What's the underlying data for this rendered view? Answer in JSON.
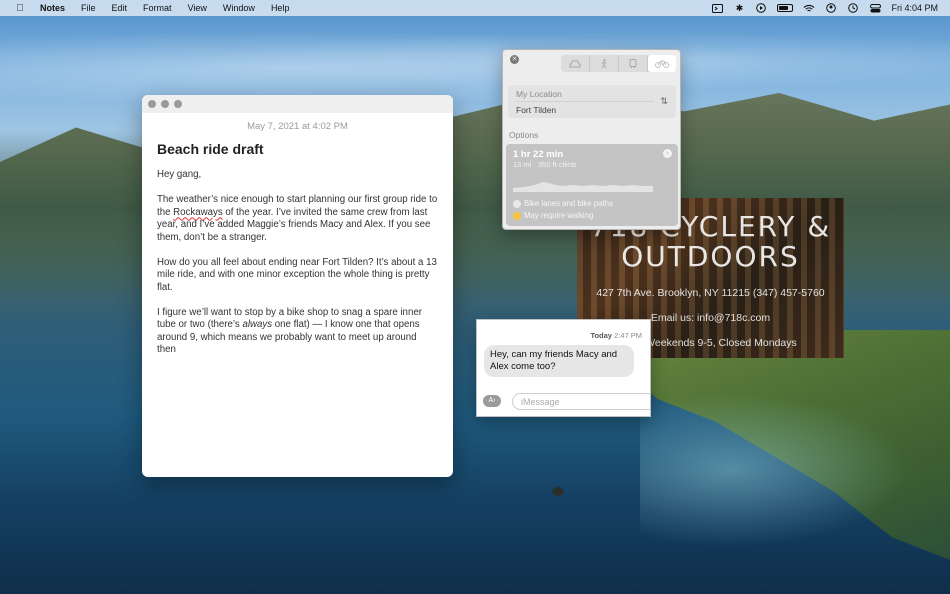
{
  "menubar": {
    "apple_icon": "apple-logo",
    "app_name": "Notes",
    "menus": [
      "File",
      "Edit",
      "Format",
      "View",
      "Window",
      "Help"
    ],
    "status_icons": [
      "screen-recording-icon",
      "bluetooth-icon",
      "play-icon",
      "battery-icon",
      "wifi-icon",
      "user-icon",
      "time-machine-icon",
      "control-center-icon"
    ],
    "clock": "Fri 4:04 PM"
  },
  "notes": {
    "date": "May 7, 2021 at 4:02 PM",
    "title": "Beach ride draft",
    "greeting": "Hey gang,",
    "p1_before": "The weather’s nice enough to start planning our first group ride to the ",
    "p1_link": "Rockaways",
    "p1_after": " of the year. I’ve invited the same crew from last year, and I’ve added Maggie’s friends Macy and Alex. If you see them, don’t be a stranger.",
    "p2": "How do you all feel about ending near Fort Tilden? It’s about a 13 mile ride, and with one minor exception the whole thing is pretty flat.",
    "p3_before": "I figure we’ll want to stop by a bike shop to snag a spare inner tube or two (there’s ",
    "p3_italic": "always",
    "p3_after": " one flat) — I know one that opens around 9, which means we probably want to meet up around then"
  },
  "maps": {
    "transport_modes": [
      "car-icon",
      "walk-icon",
      "transit-icon",
      "bike-icon"
    ],
    "selected_mode": "bike-icon",
    "from": "My Location",
    "to": "Fort Tilden",
    "options_label": "Options",
    "option": {
      "time": "1 hr 22 min",
      "detail": "13 mi · 350 ft climb",
      "note1": "Bike lanes and bike paths",
      "note2": "May require walking",
      "note2_color": "#f5c542"
    }
  },
  "shop_sign": {
    "title_line1": "718 CYCLERY &",
    "title_line2": "OUTDOORS",
    "address": "427 7th Ave. Brooklyn, NY 11215 (347) 457-5760",
    "email": "Email us: info@718c.com",
    "hours": "1-7, Weekends 9-5, Closed Mondays"
  },
  "messages": {
    "day": "Today",
    "time": "2:47 PM",
    "bubble": "Hey, can my friends Macy and Alex come too?",
    "input_placeholder": "iMessage"
  }
}
